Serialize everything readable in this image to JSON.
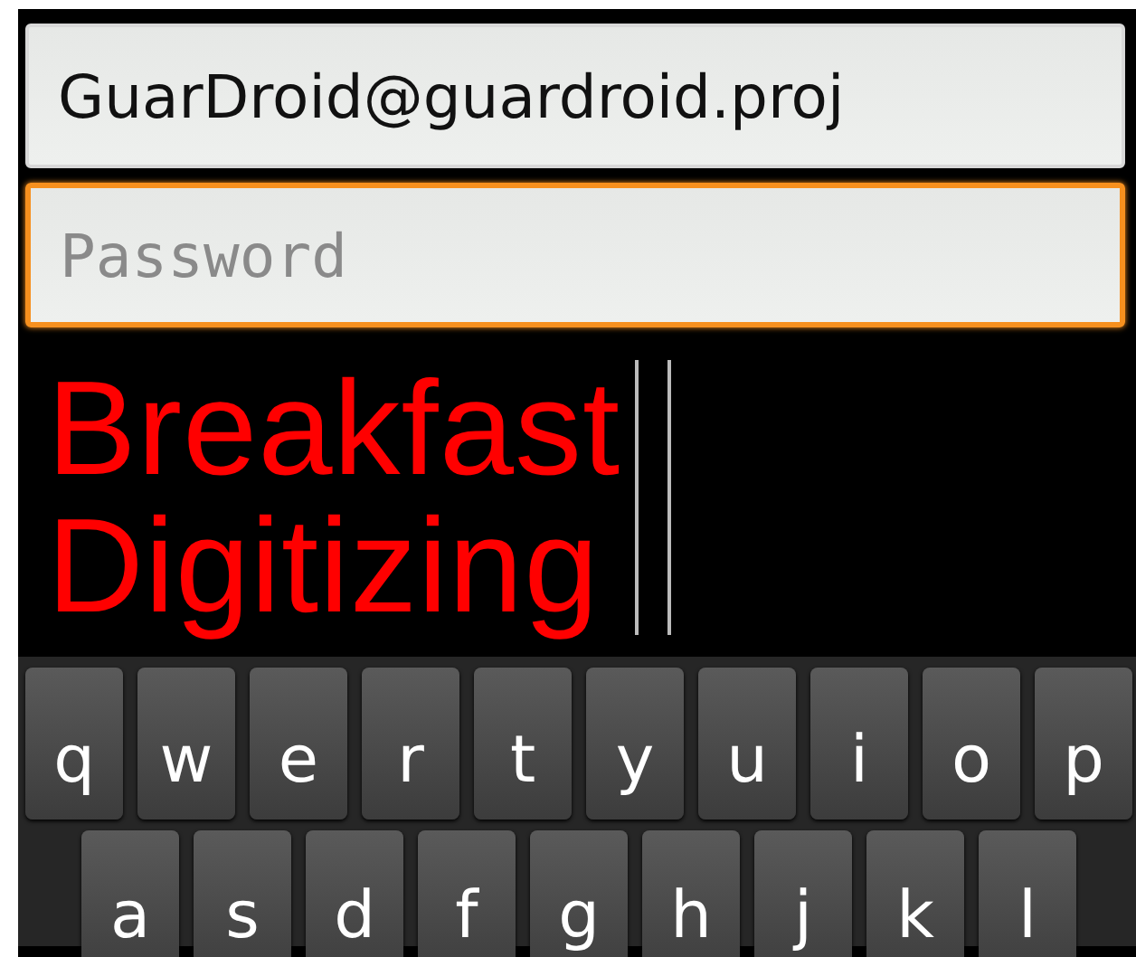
{
  "email_field": {
    "value": "GuarDroid@guardroid.proj",
    "focused": false
  },
  "password_field": {
    "placeholder": "Password",
    "focused": true
  },
  "logo": {
    "lines": [
      "Breakfast",
      "Digitizing"
    ]
  },
  "keyboard": {
    "rows": [
      {
        "keys": [
          "q",
          "w",
          "e",
          "r",
          "t",
          "y",
          "u",
          "i",
          "o",
          "p"
        ]
      },
      {
        "keys": [
          "a",
          "s",
          "d",
          "f",
          "g",
          "h",
          "j",
          "k",
          "l"
        ]
      }
    ]
  }
}
